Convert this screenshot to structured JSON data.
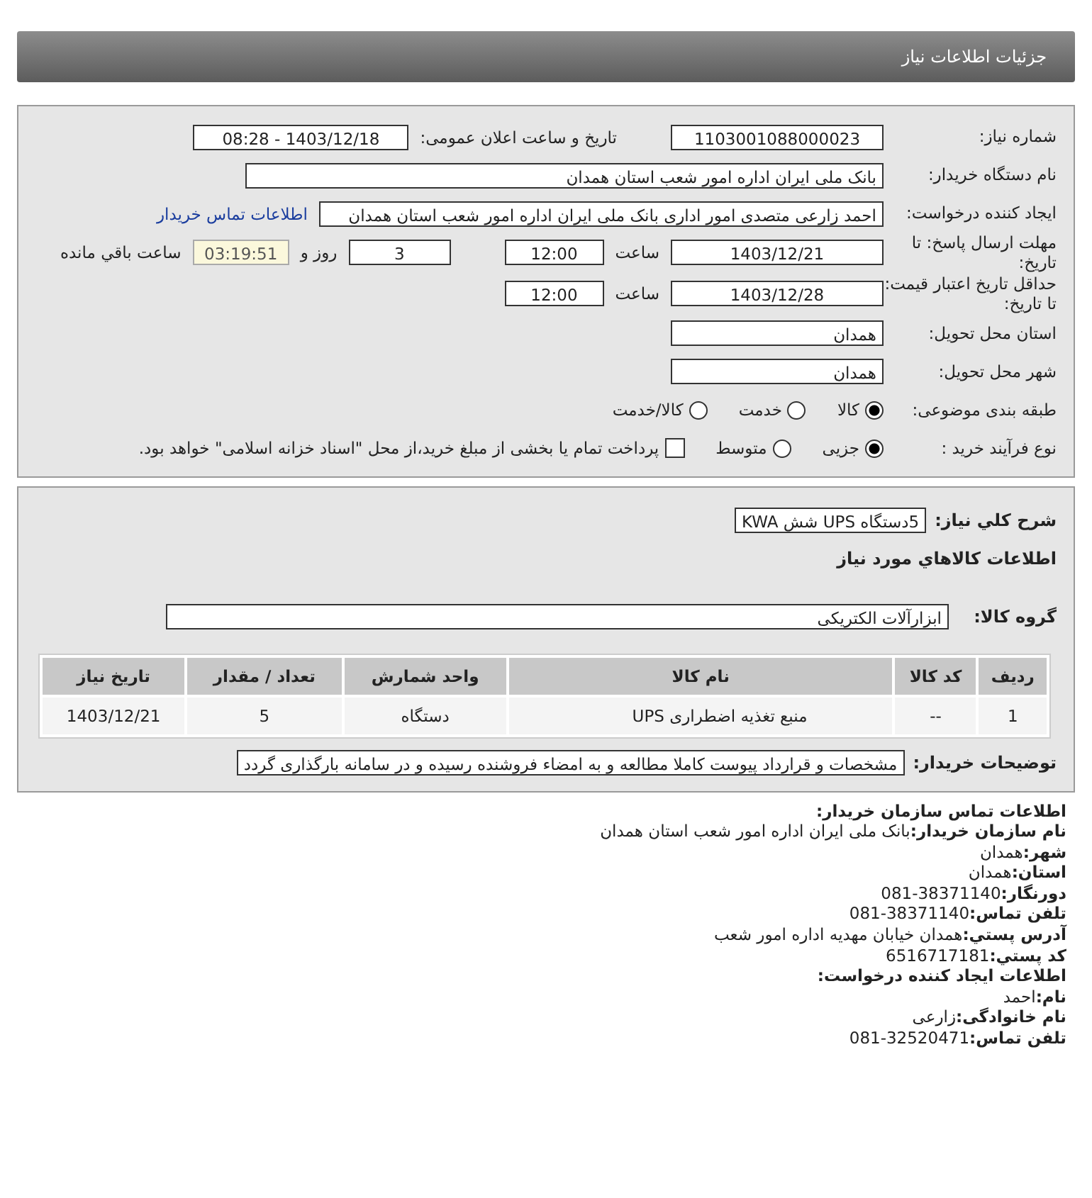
{
  "title": "جزئیات اطلاعات نیاز",
  "need_number": {
    "label": "شماره نیاز:",
    "value": "1103001088000023"
  },
  "announce": {
    "label": "تاریخ و ساعت اعلان عمومی:",
    "value": "1403/12/18 - 08:28"
  },
  "buyer": {
    "label": "نام دستگاه خریدار:",
    "value": "بانک ملی ایران اداره امور شعب استان همدان"
  },
  "requester": {
    "label": "ایجاد کننده درخواست:",
    "value": "احمد زارعی متصدی امور اداری  بانک ملی ایران اداره امور شعب استان همدان",
    "link": "اطلاعات تماس خریدار"
  },
  "deadline": {
    "label": "مهلت ارسال پاسخ: تا تاریخ:",
    "date": "1403/12/21",
    "time_label": "ساعت",
    "time": "12:00",
    "days": "3",
    "days_label": "روز و",
    "remaining": "03:19:51",
    "remaining_label": "ساعت باقي مانده"
  },
  "validity": {
    "label": "حداقل تاریخ اعتبار قیمت: تا تاریخ:",
    "date": "1403/12/28",
    "time_label": "ساعت",
    "time": "12:00"
  },
  "province": {
    "label": "استان محل تحویل:",
    "value": "همدان"
  },
  "city": {
    "label": "شهر محل تحویل:",
    "value": "همدان"
  },
  "category": {
    "label": "طبقه بندی موضوعی:",
    "options": [
      {
        "label": "کالا",
        "selected": true
      },
      {
        "label": "خدمت",
        "selected": false
      },
      {
        "label": "کالا/خدمت",
        "selected": false
      }
    ]
  },
  "process": {
    "label": "نوع فرآیند خرید :",
    "options": [
      {
        "label": "جزیی",
        "selected": true
      },
      {
        "label": "متوسط",
        "selected": false
      }
    ],
    "treasury": {
      "label": "پرداخت تمام یا بخشی از مبلغ خرید،از محل \"اسناد خزانه اسلامی\" خواهد بود.",
      "checked": false
    }
  },
  "description": {
    "label": "شرح کلي نياز:",
    "value": "5دستگاه UPS شش KWA"
  },
  "goods_heading": "اطلاعات کالاهاي مورد نياز",
  "goods_group": {
    "label": "گروه کالا:",
    "value": "ابزارآلات الکتریکی"
  },
  "table": {
    "columns": [
      "ردیف",
      "کد کالا",
      "نام کالا",
      "واحد شمارش",
      "تعداد / مقدار",
      "تاریخ نیاز"
    ],
    "rows": [
      [
        "1",
        "--",
        "منبع تغذیه اضطراری UPS",
        "دستگاه",
        "5",
        "1403/12/21"
      ]
    ]
  },
  "notes": {
    "label": "توضیحات خریدار:",
    "value": "مشخصات و قرارداد پیوست کاملا مطالعه و به امضاء فروشنده رسیده و در سامانه بارگذاری گردد"
  },
  "contact": [
    {
      "label": "اطلاعات تماس سازمان خریدار:"
    },
    {
      "label": "نام سازمان خریدار:",
      "value": "بانک ملی ایران اداره امور شعب استان همدان"
    },
    {
      "label": "شهر:",
      "value": "همدان"
    },
    {
      "label": "استان:",
      "value": "همدان"
    },
    {
      "label": "دورنگار:",
      "value": "38371140-081"
    },
    {
      "label": "تلفن تماس:",
      "value": "38371140-081"
    },
    {
      "label": "آدرس پستي:",
      "value": "همدان خیابان مهدیه اداره امور شعب"
    },
    {
      "label": "کد پستي:",
      "value": "6516717181"
    },
    {
      "label": "اطلاعات ایجاد کننده درخواست:"
    },
    {
      "label": "نام:",
      "value": "احمد"
    },
    {
      "label": "نام خانوادگی:",
      "value": "زارعی"
    },
    {
      "label": "تلفن تماس:",
      "value": "32520471-081"
    }
  ]
}
